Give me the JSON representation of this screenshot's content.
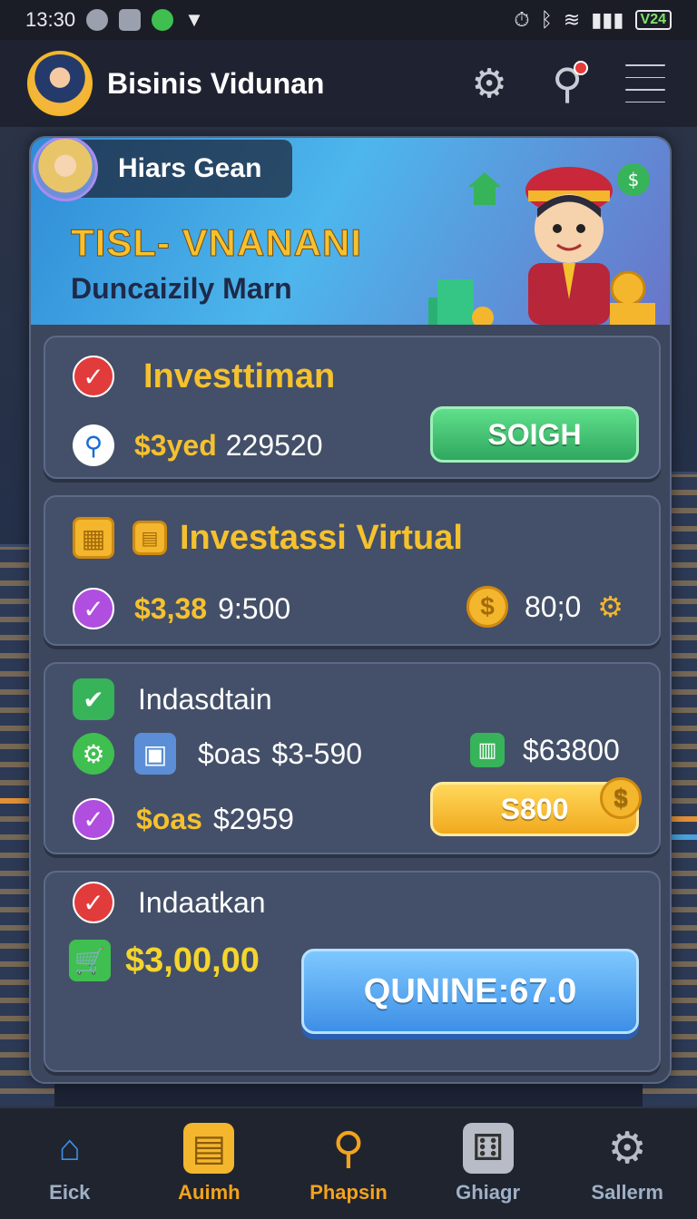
{
  "status": {
    "time": "13:30",
    "battery": "V24"
  },
  "header": {
    "title": "Bisinis Vidunan"
  },
  "banner": {
    "user_name": "Hiars Gean",
    "title": "TISL- VNANANI",
    "subtitle": "Duncaizily Marn"
  },
  "cards": [
    {
      "title": "Investtiman",
      "amount_label": "$3yed",
      "amount_value": "229520",
      "button": "SOIGH"
    },
    {
      "title": "Investassi Virtual",
      "amount_label": "$3,38",
      "amount_value": "9:500",
      "coin_value": "80;0"
    },
    {
      "title": "Indasdtain",
      "line1_label": "$oas",
      "line1_value": "$3-590",
      "line1_right": "$63800",
      "line2_label": "$oas",
      "line2_value": "$2959",
      "button": "S800"
    },
    {
      "title": "Indaatkan",
      "amount": "$3,00,00",
      "button": "QUNINE:67.0"
    }
  ],
  "nav": [
    {
      "label": "Eick",
      "color": "#9fb0c6"
    },
    {
      "label": "Auimh",
      "color": "#f2a31d"
    },
    {
      "label": "Phapsin",
      "color": "#f2a31d"
    },
    {
      "label": "Ghiagr",
      "color": "#9fb0c6"
    },
    {
      "label": "Sallerm",
      "color": "#9fb0c6"
    }
  ],
  "colors": {
    "accent_gold": "#f5c12e",
    "accent_green": "#3fbf4f",
    "accent_blue": "#3d8fe6"
  }
}
